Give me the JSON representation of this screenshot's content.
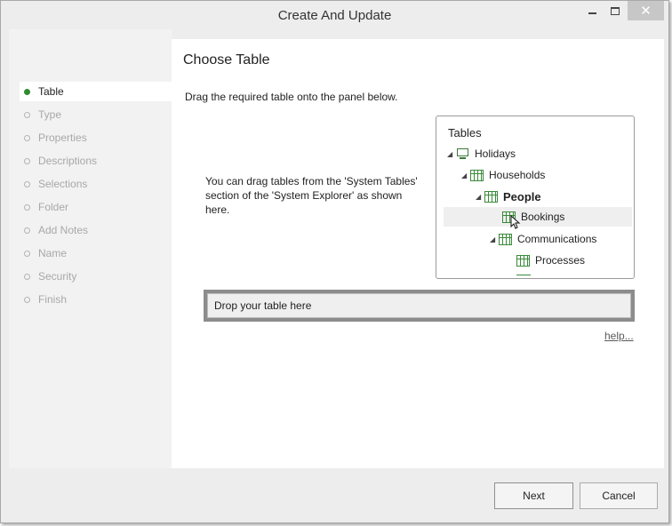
{
  "window": {
    "title": "Create And Update"
  },
  "controls": {
    "minimize": "minimize",
    "maximize": "maximize",
    "close": "✕"
  },
  "sidebar": {
    "items": [
      {
        "label": "Table",
        "active": true
      },
      {
        "label": "Type",
        "active": false
      },
      {
        "label": "Properties",
        "active": false
      },
      {
        "label": "Descriptions",
        "active": false
      },
      {
        "label": "Selections",
        "active": false
      },
      {
        "label": "Folder",
        "active": false
      },
      {
        "label": "Add Notes",
        "active": false
      },
      {
        "label": "Name",
        "active": false
      },
      {
        "label": "Security",
        "active": false
      },
      {
        "label": "Finish",
        "active": false
      }
    ]
  },
  "main": {
    "heading": "Choose Table",
    "instruction": "Drag the required table onto the panel below.",
    "hint": "You can drag tables from the 'System Tables' section of the 'System Explorer' as shown here.",
    "tables_panel": {
      "title": "Tables",
      "tree": [
        {
          "label": "Holidays",
          "icon": "computer-icon",
          "expanded": true,
          "bold": false
        },
        {
          "label": "Households",
          "icon": "table-icon",
          "expanded": true,
          "bold": false
        },
        {
          "label": "People",
          "icon": "table-icon",
          "expanded": true,
          "bold": true
        },
        {
          "label": "Bookings",
          "icon": "table-icon",
          "expanded": false,
          "bold": false,
          "highlighted": true
        },
        {
          "label": "Communications",
          "icon": "table-icon",
          "expanded": true,
          "bold": false
        },
        {
          "label": "Processes",
          "icon": "table-icon",
          "expanded": false,
          "bold": false
        }
      ]
    },
    "drop_zone": {
      "placeholder": "Drop your table here"
    },
    "help_link": "help..."
  },
  "footer": {
    "next_label": "Next",
    "cancel_label": "Cancel"
  },
  "colors": {
    "active_dot": "#2e8b2e",
    "table_icon": "#3a8a3a",
    "close_button": "#c7c7c7"
  }
}
